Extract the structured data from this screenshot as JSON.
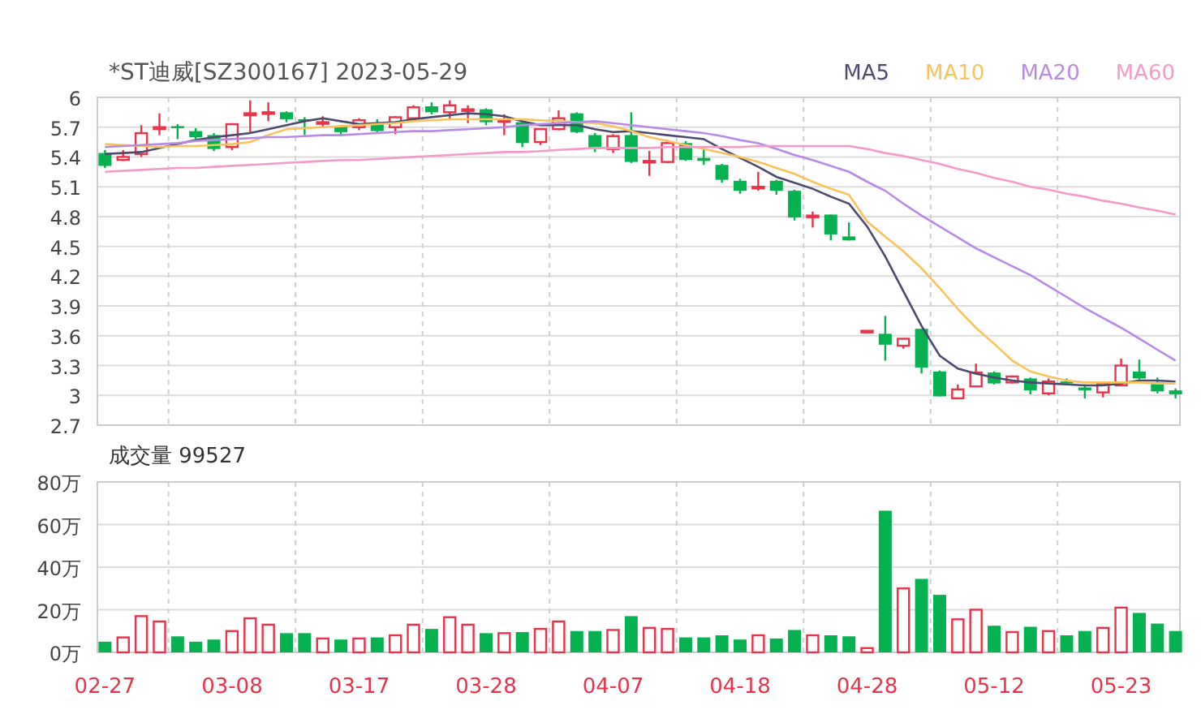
{
  "header": {
    "title": "*ST迪威[SZ300167] 2023-05-29"
  },
  "price_chart": {
    "chart_data": {
      "type": "candlestick",
      "grid": true,
      "ylim": [
        2.7,
        6
      ],
      "yticks": [
        6,
        5.7,
        5.4,
        5.1,
        4.8,
        4.5,
        4.2,
        3.9,
        3.6,
        3.3,
        3,
        2.7
      ],
      "series": [
        {
          "name": "MA5",
          "type": "line",
          "color": "#4c4a6e",
          "values": [
            5.43,
            5.44,
            5.45,
            5.49,
            5.53,
            5.57,
            5.6,
            5.62,
            5.64,
            5.68,
            5.72,
            5.76,
            5.79,
            5.76,
            5.73,
            5.74,
            5.75,
            5.78,
            5.8,
            5.82,
            5.84,
            5.83,
            5.81,
            5.76,
            5.72,
            5.72,
            5.72,
            5.68,
            5.65,
            5.66,
            5.64,
            5.62,
            5.6,
            5.58,
            5.48,
            5.39,
            5.3,
            5.2,
            5.14,
            5.08,
            5.0,
            4.93,
            4.7,
            4.4,
            4.05,
            3.7,
            3.4,
            3.27,
            3.22,
            3.18,
            3.15,
            3.13,
            3.12,
            3.11,
            3.1,
            3.1,
            3.12,
            3.15,
            3.15,
            3.14
          ]
        },
        {
          "name": "MA10",
          "type": "line",
          "color": "#f8c35a",
          "values": [
            5.53,
            5.52,
            5.51,
            5.5,
            5.51,
            5.51,
            5.52,
            5.53,
            5.55,
            5.62,
            5.68,
            5.69,
            5.7,
            5.71,
            5.72,
            5.73,
            5.74,
            5.76,
            5.77,
            5.78,
            5.78,
            5.78,
            5.78,
            5.78,
            5.77,
            5.76,
            5.75,
            5.74,
            5.71,
            5.66,
            5.6,
            5.56,
            5.52,
            5.48,
            5.44,
            5.4,
            5.35,
            5.29,
            5.23,
            5.15,
            5.08,
            5.02,
            4.75,
            4.6,
            4.45,
            4.28,
            4.08,
            3.87,
            3.68,
            3.52,
            3.35,
            3.24,
            3.19,
            3.15,
            3.13,
            3.13,
            3.13,
            3.13,
            3.12,
            3.12
          ]
        },
        {
          "name": "MA20",
          "type": "line",
          "color": "#b88ae6",
          "values": [
            5.5,
            5.51,
            5.52,
            5.53,
            5.54,
            5.56,
            5.57,
            5.58,
            5.59,
            5.6,
            5.6,
            5.61,
            5.62,
            5.62,
            5.63,
            5.64,
            5.65,
            5.66,
            5.66,
            5.67,
            5.68,
            5.69,
            5.7,
            5.72,
            5.73,
            5.74,
            5.75,
            5.76,
            5.74,
            5.72,
            5.7,
            5.68,
            5.66,
            5.64,
            5.61,
            5.57,
            5.54,
            5.48,
            5.42,
            5.37,
            5.31,
            5.25,
            5.15,
            5.06,
            4.93,
            4.81,
            4.7,
            4.59,
            4.48,
            4.39,
            4.3,
            4.21,
            4.1,
            3.99,
            3.88,
            3.78,
            3.68,
            3.57,
            3.46,
            3.35
          ]
        },
        {
          "name": "MA60",
          "type": "line",
          "color": "#f59ac8",
          "values": [
            5.25,
            5.26,
            5.27,
            5.28,
            5.29,
            5.29,
            5.3,
            5.31,
            5.32,
            5.33,
            5.34,
            5.35,
            5.36,
            5.37,
            5.37,
            5.38,
            5.39,
            5.4,
            5.41,
            5.42,
            5.43,
            5.44,
            5.45,
            5.45,
            5.46,
            5.47,
            5.48,
            5.49,
            5.49,
            5.49,
            5.49,
            5.5,
            5.5,
            5.5,
            5.5,
            5.5,
            5.51,
            5.51,
            5.51,
            5.51,
            5.51,
            5.51,
            5.48,
            5.44,
            5.41,
            5.37,
            5.33,
            5.28,
            5.24,
            5.19,
            5.15,
            5.1,
            5.07,
            5.03,
            5.0,
            4.96,
            4.93,
            4.89,
            4.86,
            4.82
          ]
        }
      ],
      "ohlc": [
        [
          5.44,
          5.47,
          5.29,
          5.31
        ],
        [
          5.37,
          5.47,
          5.36,
          5.4
        ],
        [
          5.43,
          5.72,
          5.4,
          5.64
        ],
        [
          5.68,
          5.84,
          5.62,
          5.7
        ],
        [
          5.71,
          5.73,
          5.58,
          5.69
        ],
        [
          5.66,
          5.69,
          5.58,
          5.6
        ],
        [
          5.62,
          5.64,
          5.46,
          5.48
        ],
        [
          5.5,
          5.74,
          5.47,
          5.73
        ],
        [
          5.82,
          5.97,
          5.65,
          5.84
        ],
        [
          5.84,
          5.95,
          5.76,
          5.85
        ],
        [
          5.85,
          5.86,
          5.75,
          5.78
        ],
        [
          5.78,
          5.8,
          5.62,
          5.76
        ],
        [
          5.74,
          5.81,
          5.7,
          5.75
        ],
        [
          5.71,
          5.72,
          5.61,
          5.65
        ],
        [
          5.7,
          5.79,
          5.67,
          5.77
        ],
        [
          5.74,
          5.78,
          5.65,
          5.66
        ],
        [
          5.7,
          5.81,
          5.63,
          5.8
        ],
        [
          5.79,
          5.92,
          5.76,
          5.9
        ],
        [
          5.91,
          5.95,
          5.83,
          5.85
        ],
        [
          5.85,
          5.97,
          5.78,
          5.92
        ],
        [
          5.87,
          5.92,
          5.74,
          5.88
        ],
        [
          5.88,
          5.89,
          5.72,
          5.75
        ],
        [
          5.76,
          5.83,
          5.62,
          5.77
        ],
        [
          5.75,
          5.76,
          5.5,
          5.54
        ],
        [
          5.55,
          5.69,
          5.52,
          5.68
        ],
        [
          5.68,
          5.87,
          5.67,
          5.79
        ],
        [
          5.84,
          5.85,
          5.64,
          5.65
        ],
        [
          5.62,
          5.64,
          5.45,
          5.48
        ],
        [
          5.48,
          5.63,
          5.44,
          5.61
        ],
        [
          5.62,
          5.85,
          5.34,
          5.35
        ],
        [
          5.35,
          5.46,
          5.21,
          5.36
        ],
        [
          5.35,
          5.57,
          5.34,
          5.54
        ],
        [
          5.54,
          5.56,
          5.36,
          5.37
        ],
        [
          5.39,
          5.49,
          5.32,
          5.36
        ],
        [
          5.32,
          5.33,
          5.14,
          5.17
        ],
        [
          5.16,
          5.18,
          5.03,
          5.06
        ],
        [
          5.09,
          5.25,
          5.06,
          5.1
        ],
        [
          5.16,
          5.17,
          5.02,
          5.06
        ],
        [
          5.06,
          5.07,
          4.76,
          4.79
        ],
        [
          4.8,
          4.85,
          4.69,
          4.81
        ],
        [
          4.82,
          4.82,
          4.56,
          4.62
        ],
        [
          4.6,
          4.74,
          4.56,
          4.56
        ],
        [
          3.65,
          3.65,
          3.65,
          3.65
        ],
        [
          3.62,
          3.8,
          3.35,
          3.51
        ],
        [
          3.5,
          3.57,
          3.47,
          3.57
        ],
        [
          3.67,
          3.67,
          3.22,
          3.28
        ],
        [
          3.24,
          3.25,
          2.99,
          2.99
        ],
        [
          2.97,
          3.11,
          2.97,
          3.06
        ],
        [
          3.09,
          3.32,
          3.09,
          3.23
        ],
        [
          3.23,
          3.24,
          3.11,
          3.12
        ],
        [
          3.13,
          3.2,
          3.12,
          3.19
        ],
        [
          3.17,
          3.18,
          3.01,
          3.05
        ],
        [
          3.02,
          3.17,
          3.0,
          3.14
        ],
        [
          3.14,
          3.17,
          3.11,
          3.12
        ],
        [
          3.08,
          3.11,
          2.97,
          3.05
        ],
        [
          3.03,
          3.12,
          2.98,
          3.12
        ],
        [
          3.1,
          3.37,
          3.1,
          3.3
        ],
        [
          3.24,
          3.36,
          3.16,
          3.17
        ],
        [
          3.13,
          3.18,
          3.02,
          3.04
        ],
        [
          3.05,
          3.07,
          2.97,
          3.01
        ]
      ]
    }
  },
  "volume_chart": {
    "label": "成交量 99527",
    "chart_data": {
      "type": "bar",
      "grid": true,
      "ylim": [
        0,
        80
      ],
      "yticks": [
        {
          "value": 80,
          "label": "80万"
        },
        {
          "value": 60,
          "label": "60万"
        },
        {
          "value": 40,
          "label": "40万"
        },
        {
          "value": 20,
          "label": "20万"
        },
        {
          "value": 0,
          "label": "0万"
        }
      ],
      "categories": [
        "02-27",
        null,
        null,
        null,
        null,
        null,
        null,
        "03-08",
        null,
        null,
        null,
        null,
        null,
        null,
        "03-17",
        null,
        null,
        null,
        null,
        null,
        null,
        "03-28",
        null,
        null,
        null,
        null,
        null,
        null,
        "04-07",
        null,
        null,
        null,
        null,
        null,
        null,
        "04-18",
        null,
        null,
        null,
        null,
        null,
        null,
        "04-28",
        null,
        null,
        null,
        null,
        null,
        null,
        "05-12",
        null,
        null,
        null,
        null,
        null,
        null,
        "05-23",
        null,
        null,
        null
      ],
      "values": [
        5,
        7,
        17,
        14.5,
        7.5,
        5,
        6,
        10,
        16,
        13,
        9,
        9,
        6.5,
        6,
        6.5,
        7,
        8,
        13,
        11,
        16.5,
        13,
        9,
        9,
        9.5,
        11,
        14.5,
        10,
        10,
        10.5,
        17,
        11.5,
        11,
        7,
        7,
        8,
        6,
        8,
        6.5,
        10.5,
        8,
        8,
        7.5,
        2,
        66.5,
        30,
        34.5,
        27,
        15.5,
        20,
        12.5,
        9.5,
        12,
        10,
        8,
        10,
        11.5,
        21,
        18.5,
        13.5,
        10
      ]
    }
  }
}
